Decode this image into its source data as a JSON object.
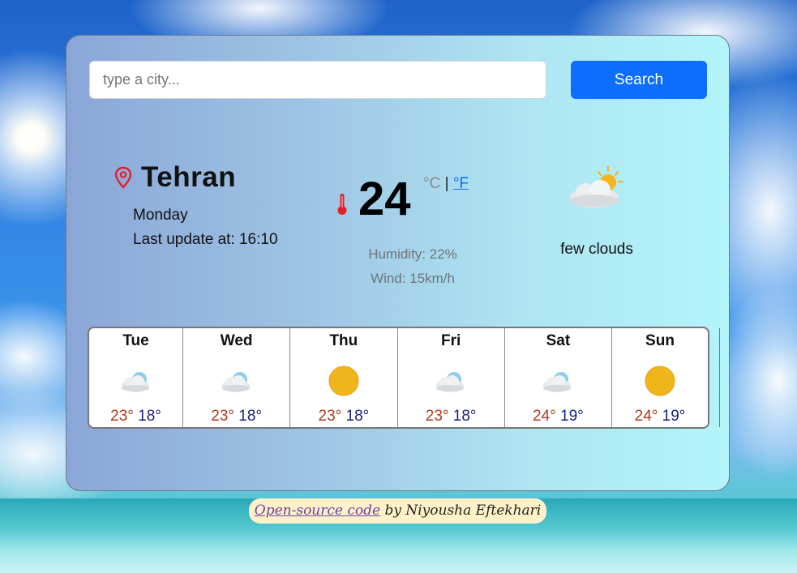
{
  "search": {
    "placeholder": "type a city...",
    "button_label": "Search"
  },
  "current": {
    "city": "Tehran",
    "day": "Monday",
    "last_update": "Last update at: 16:10",
    "temperature": "24",
    "unit_c": "°C",
    "unit_separator": "|",
    "unit_f": "°F",
    "humidity": "Humidity: 22%",
    "wind": "Wind: 15km/h",
    "description": "few clouds",
    "icon": "few-clouds-icon"
  },
  "forecast": [
    {
      "day": "Tue",
      "icon": "cloudy-icon",
      "max": "23°",
      "min": "18°"
    },
    {
      "day": "Wed",
      "icon": "cloudy-icon",
      "max": "23°",
      "min": "18°"
    },
    {
      "day": "Thu",
      "icon": "sun-icon",
      "max": "23°",
      "min": "18°"
    },
    {
      "day": "Fri",
      "icon": "cloudy-icon",
      "max": "23°",
      "min": "18°"
    },
    {
      "day": "Sat",
      "icon": "cloudy-icon",
      "max": "24°",
      "min": "19°"
    },
    {
      "day": "Sun",
      "icon": "sun-icon",
      "max": "24°",
      "min": "19°"
    }
  ],
  "footer": {
    "link_text": "Open-source code",
    "author_text": " by Niyousha Eftekhari"
  },
  "colors": {
    "accent": "#0d6efd",
    "max_temp": "#b0391e",
    "min_temp": "#1a237e",
    "pin": "#e0202a"
  }
}
